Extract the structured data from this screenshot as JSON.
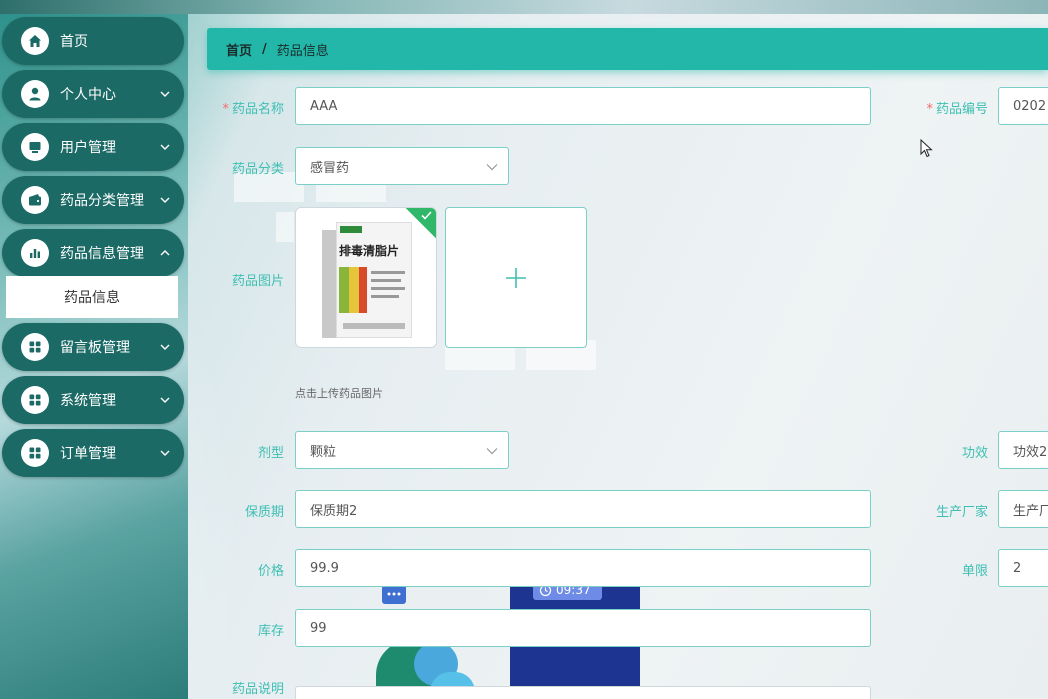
{
  "sidebar": {
    "items": [
      {
        "label": "首页",
        "icon": "home-icon",
        "expandable": false
      },
      {
        "label": "个人中心",
        "icon": "user-icon",
        "expandable": true
      },
      {
        "label": "用户管理",
        "icon": "monitor-icon",
        "expandable": true
      },
      {
        "label": "药品分类管理",
        "icon": "wallet-icon",
        "expandable": true
      },
      {
        "label": "药品信息管理",
        "icon": "bar-chart-icon",
        "expandable": true
      },
      {
        "label": "留言板管理",
        "icon": "grid-icon",
        "expandable": true
      },
      {
        "label": "系统管理",
        "icon": "grid-icon",
        "expandable": true
      },
      {
        "label": "订单管理",
        "icon": "grid-icon",
        "expandable": true
      }
    ],
    "active_sub_item": "药品信息"
  },
  "breadcrumb": {
    "home": "首页",
    "separator": "/",
    "current": "药品信息"
  },
  "form": {
    "name": {
      "label": "药品名称",
      "required": true,
      "value": "AAA"
    },
    "code": {
      "label": "药品编号",
      "required": true,
      "value": "0202"
    },
    "category": {
      "label": "药品分类",
      "value": "感冒药"
    },
    "image": {
      "label": "药品图片",
      "hint": "点击上传药品图片",
      "product_box_text": "排毒清脂片"
    },
    "dosage_form": {
      "label": "剂型",
      "value": "颗粒"
    },
    "efficacy": {
      "label": "功效",
      "value": "功效2"
    },
    "shelf_life": {
      "label": "保质期",
      "value": "保质期2"
    },
    "manufacturer": {
      "label": "生产厂家",
      "value": "生产厂"
    },
    "price": {
      "label": "价格",
      "value": "99.9"
    },
    "limit": {
      "label": "单限",
      "value": "2"
    },
    "stock": {
      "label": "库存",
      "value": "99"
    },
    "description": {
      "label": "药品说明"
    }
  },
  "illustration": {
    "clock_text": "09:37"
  },
  "colors": {
    "accent": "#22b7a9",
    "sidebar_item": "#1c6a66",
    "label": "#3fbfb3",
    "required": "#f56c6c",
    "border": "#7ccfc6"
  }
}
